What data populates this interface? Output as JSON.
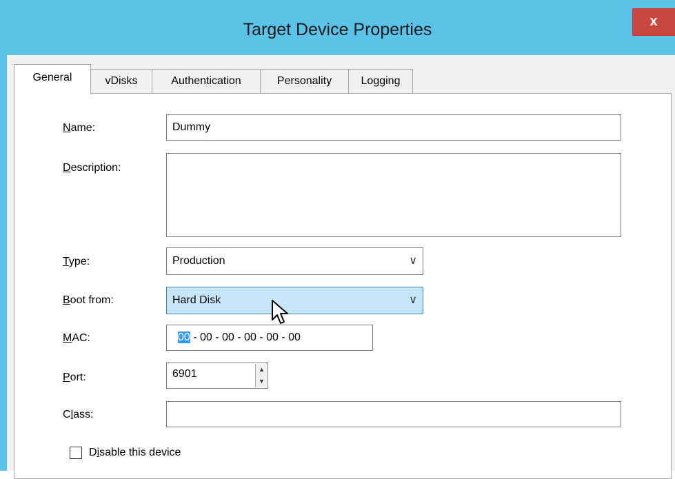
{
  "window": {
    "title": "Target Device Properties",
    "close_label": "x"
  },
  "tabs": [
    {
      "label": "General",
      "active": true
    },
    {
      "label": "vDisks",
      "active": false
    },
    {
      "label": "Authentication",
      "active": false
    },
    {
      "label": "Personality",
      "active": false
    },
    {
      "label": "Logging",
      "active": false
    }
  ],
  "form": {
    "name": {
      "label_underline": "N",
      "label_rest": "ame:",
      "value": "Dummy"
    },
    "description": {
      "label_underline": "D",
      "label_rest": "escription:",
      "value": ""
    },
    "type": {
      "label_underline": "T",
      "label_rest": "ype:",
      "value": "Production"
    },
    "boot_from": {
      "label_underline": "B",
      "label_rest": "oot from:",
      "value": "Hard Disk"
    },
    "mac": {
      "label_underline": "M",
      "label_rest": "AC:",
      "first_octet": "00",
      "rest": " - 00 - 00 - 00 - 00 - 00"
    },
    "port": {
      "label_underline": "P",
      "label_rest": "ort:",
      "value": "6901"
    },
    "class": {
      "label_before": "C",
      "label_underline": "l",
      "label_rest": "ass:",
      "value": ""
    },
    "disable": {
      "label_before": "D",
      "label_underline": "i",
      "label_rest": "sable this device",
      "checked": false
    }
  },
  "colors": {
    "titlebar": "#5bc2e8",
    "close_button": "#c7463f",
    "combo_hover": "#c6e6f8",
    "selection": "#3399ff"
  }
}
